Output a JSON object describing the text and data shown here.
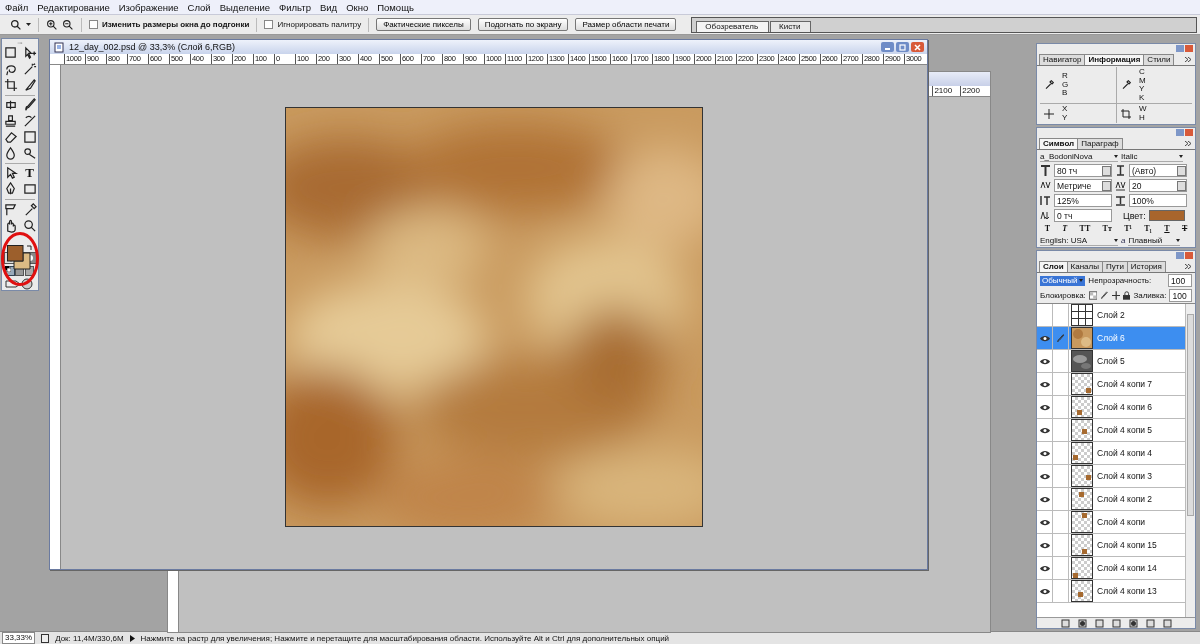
{
  "menu": [
    "Файл",
    "Редактирование",
    "Изображение",
    "Слой",
    "Выделение",
    "Фильтр",
    "Вид",
    "Окно",
    "Помощь"
  ],
  "options_bar": {
    "checkboxes": [
      {
        "label": "Изменить размеры окна до подгонки",
        "checked": false
      },
      {
        "label": "Игнорировать палитру",
        "checked": false
      }
    ],
    "buttons": [
      "Фактические пикселы",
      "Подогнать по экрану",
      "Размер области печати"
    ]
  },
  "palette_well": {
    "tabs": [
      {
        "label": "Обозреватель",
        "selected": true
      },
      {
        "label": "Кисти",
        "selected": false
      }
    ]
  },
  "toolbox": {
    "type_tool_glyph": "T",
    "swatches": [
      {
        "kind": "foreground",
        "color": "#9c5f2c"
      },
      {
        "kind": "background",
        "color": "#dcbb84"
      }
    ]
  },
  "document": {
    "title": "12_day_002.psd @ 33,3% (Слой 6,RGB)",
    "ruler_ticks": [
      "1000",
      "900",
      "800",
      "700",
      "600",
      "500",
      "400",
      "300",
      "200",
      "100",
      "0",
      "100",
      "200",
      "300",
      "400",
      "500",
      "600",
      "700",
      "800",
      "900",
      "1000",
      "1100",
      "1200",
      "1300",
      "1400",
      "1500",
      "1600",
      "1700",
      "1800",
      "1900",
      "2000",
      "2100",
      "2200",
      "2300",
      "2400",
      "2500",
      "2600",
      "2700",
      "2800",
      "2900",
      "3000"
    ]
  },
  "back_document": {
    "ruler_ticks": [
      "2100",
      "2200"
    ]
  },
  "info_panel": {
    "tabs": [
      {
        "label": "Навигатор",
        "selected": false
      },
      {
        "label": "Информация",
        "selected": true
      },
      {
        "label": "Стили",
        "selected": false
      }
    ],
    "rgb_labels": [
      "R",
      "G",
      "B"
    ],
    "cmyk_labels": [
      "C",
      "M",
      "Y",
      "K"
    ],
    "xy_labels": [
      "X",
      "Y"
    ],
    "wh_labels": [
      "W",
      "H"
    ]
  },
  "character_panel": {
    "tabs": [
      {
        "label": "Символ",
        "selected": true
      },
      {
        "label": "Параграф",
        "selected": false
      }
    ],
    "font": "a_BodoniNova",
    "style": "Italic",
    "size": "80 тч",
    "leading": "(Авто)",
    "kerning": "Метриче",
    "tracking": "20",
    "vertical_scale": "125%",
    "horizontal_scale": "100%",
    "baseline": "0 тч",
    "color_label": "Цвет:",
    "color": "#a8652c",
    "style_buttons": [
      "T",
      "T",
      "TT",
      "Tт",
      "T¹",
      "T₁",
      "T",
      "T"
    ],
    "language": "English: USA",
    "antialias_glyph": "a",
    "antialias": "Плавный"
  },
  "layers_panel": {
    "tabs": [
      {
        "label": "Слои",
        "selected": true
      },
      {
        "label": "Каналы",
        "selected": false
      },
      {
        "label": "Пути",
        "selected": false
      },
      {
        "label": "История",
        "selected": false
      }
    ],
    "blend_mode": "Обычный",
    "opacity_label": "Непрозрачность:",
    "opacity": "100",
    "lock_label": "Блокировка:",
    "fill_label": "Заливка:",
    "fill": "100",
    "layers": [
      {
        "name": "Слой 2",
        "visible": false,
        "selected": false,
        "linked": false,
        "kind": "grid"
      },
      {
        "name": "Слой 6",
        "visible": true,
        "selected": true,
        "linked": true,
        "kind": "texture"
      },
      {
        "name": "Слой 5",
        "visible": true,
        "selected": false,
        "linked": false,
        "kind": "smoke"
      },
      {
        "name": "Слой 4 копи 7",
        "visible": true,
        "selected": false,
        "linked": false,
        "kind": "checker"
      },
      {
        "name": "Слой 4 копи 6",
        "visible": true,
        "selected": false,
        "linked": false,
        "kind": "checker"
      },
      {
        "name": "Слой 4 копи 5",
        "visible": true,
        "selected": false,
        "linked": false,
        "kind": "checker"
      },
      {
        "name": "Слой 4 копи 4",
        "visible": true,
        "selected": false,
        "linked": false,
        "kind": "checker"
      },
      {
        "name": "Слой 4 копи 3",
        "visible": true,
        "selected": false,
        "linked": false,
        "kind": "checker"
      },
      {
        "name": "Слой 4 копи 2",
        "visible": true,
        "selected": false,
        "linked": false,
        "kind": "checker"
      },
      {
        "name": "Слой 4 копи",
        "visible": true,
        "selected": false,
        "linked": false,
        "kind": "checker"
      },
      {
        "name": "Слой 4 копи 15",
        "visible": true,
        "selected": false,
        "linked": false,
        "kind": "checker"
      },
      {
        "name": "Слой 4 копи 14",
        "visible": true,
        "selected": false,
        "linked": false,
        "kind": "checker"
      },
      {
        "name": "Слой 4 копи 13",
        "visible": true,
        "selected": false,
        "linked": false,
        "kind": "checker"
      }
    ]
  },
  "status_bar": {
    "zoom": "33,33%",
    "doc": "Док: 11,4M/330,6M",
    "hint": "Нажмите на растр для увеличения; Нажмите и перетащите для масштабирования области. Используйте Alt и Ctrl для дополнительных опций"
  }
}
